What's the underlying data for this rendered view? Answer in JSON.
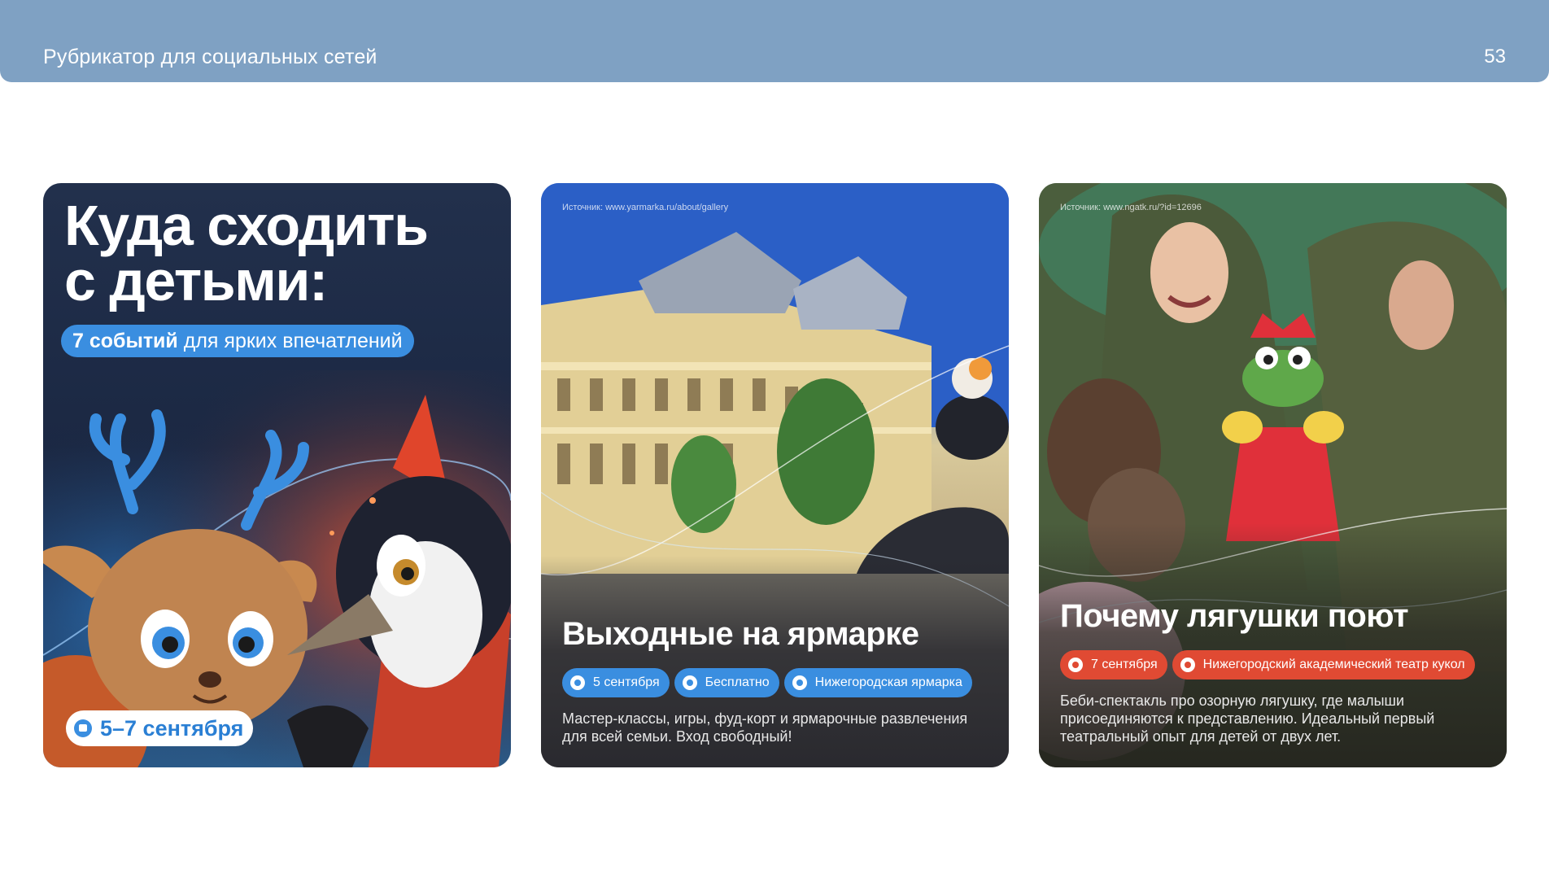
{
  "header": {
    "title": "Рубрикатор для социальных сетей",
    "page_number": "53",
    "color": "#7fa1c3"
  },
  "cards": [
    {
      "headline_line1": "Куда сходить",
      "headline_line2": "с детьми:",
      "subtitle_bold": "7 событий",
      "subtitle_rest": " для ярких впечатлений",
      "date": "5–7 сентября",
      "icon": "calendar-icon"
    },
    {
      "source": "Источник: www.yarmarka.ru/about/gallery",
      "title": "Выходные на ярмарке",
      "chips": [
        {
          "icon": "calendar-icon",
          "label": "5 сентября"
        },
        {
          "icon": "ruble-icon",
          "label": "Бесплатно"
        },
        {
          "icon": "location-pin-icon",
          "label": "Нижегородская ярмарка"
        }
      ],
      "description": "Мастер-классы, игры, фуд-корт и ярмарочные развлечения для всей семьи. Вход свободный!",
      "accent": "#3a8ee0"
    },
    {
      "source": "Источник: www.ngatk.ru/?id=12696",
      "title": "Почему лягушки поют",
      "chips": [
        {
          "icon": "calendar-icon",
          "label": "7 сентября"
        },
        {
          "icon": "location-pin-icon",
          "label": "Нижегородский академический театр кукол"
        }
      ],
      "description": "Беби-спектакль про озорную лягушку, где малыши присоединяются к представлению. Идеальный первый театральный опыт для детей от двух лет.",
      "accent": "#e04a33"
    }
  ]
}
